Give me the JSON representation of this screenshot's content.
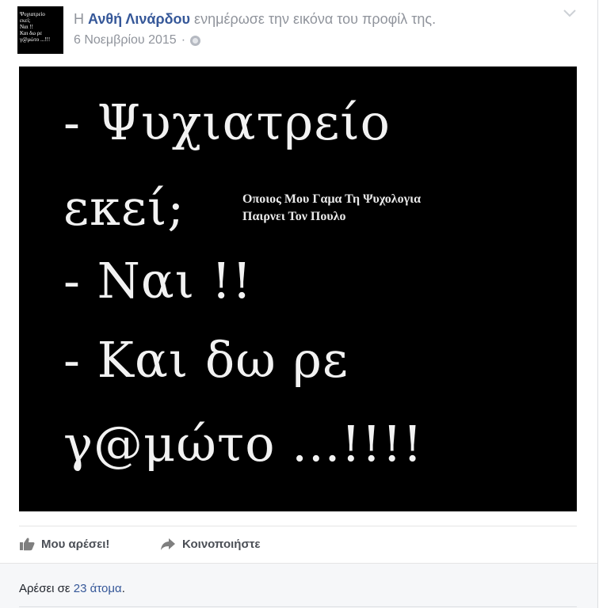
{
  "post": {
    "headline": {
      "prefix": "Η",
      "actor": "Ανθή Λινάρδου",
      "action": "ενημέρωσε την εικόνα του προφίλ της."
    },
    "date": "6 Νοεμβρίου 2015",
    "separator": "·",
    "privacy_icon": "globe-icon",
    "menu_icon": "chevron-down-icon",
    "avatar_thumbnail_text": [
      "Ψυχιατρείο",
      "εκεί;",
      "Ναι !!",
      "Και δω ρε",
      "γ@μώτο ...!!!"
    ],
    "image": {
      "lines": [
        "- Ψυχιατρείο",
        "εκεί;",
        "- Ναι !!",
        "- Και δω ρε",
        "γ@μώτο ...!!!!"
      ],
      "caption": [
        "Οποιος Μου Γαμα Τη Ψυχολογια",
        "Παιρνει Τον Πουλο"
      ]
    },
    "actions": {
      "like_label": "Μου αρέσει!",
      "share_label": "Κοινοποιήστε"
    },
    "likes": {
      "prefix": "Αρέσει σε",
      "count": "23 άτομα",
      "suffix": "."
    }
  }
}
